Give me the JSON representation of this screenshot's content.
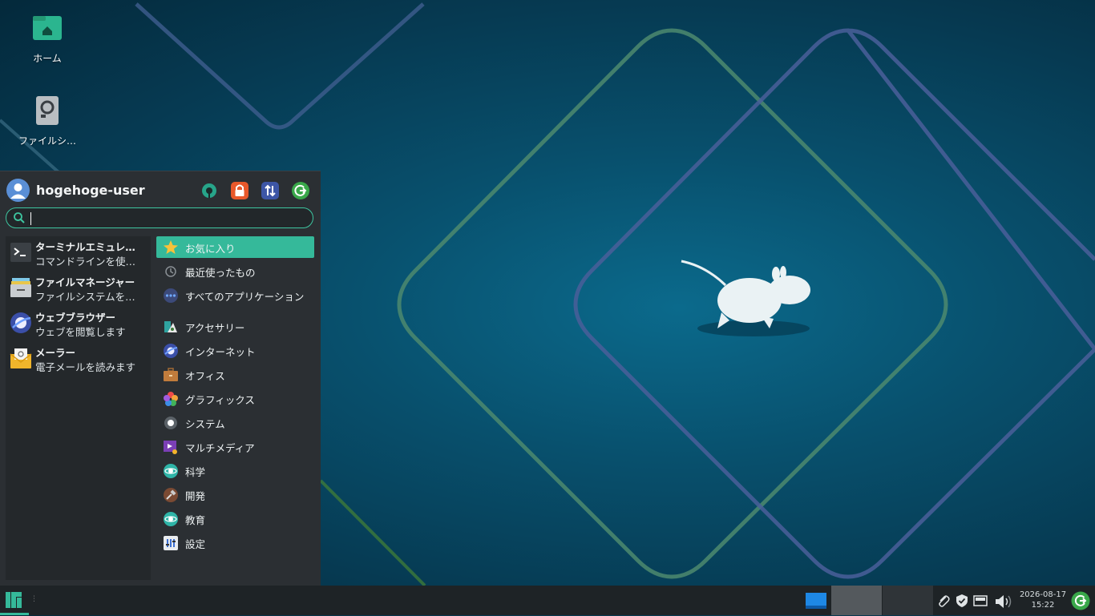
{
  "desktop": {
    "icons": [
      {
        "label": "ホーム",
        "icon": "home-folder-icon"
      },
      {
        "label": "ファイルシ…",
        "icon": "filesystem-drive-icon"
      }
    ]
  },
  "menu": {
    "username": "hogehoge-user",
    "header_buttons": [
      "settings-icon",
      "lock-icon",
      "switch-user-icon",
      "logout-icon"
    ],
    "search": {
      "value": "",
      "placeholder": ""
    },
    "favorites": [
      {
        "name": "ターミナルエミュレ…",
        "desc": "コマンドラインを使…",
        "icon": "terminal-icon"
      },
      {
        "name": "ファイルマネージャー",
        "desc": "ファイルシステムを…",
        "icon": "file-manager-icon"
      },
      {
        "name": "ウェブブラウザー",
        "desc": "ウェブを閲覧します",
        "icon": "web-browser-icon"
      },
      {
        "name": "メーラー",
        "desc": "電子メールを読みます",
        "icon": "mail-icon"
      }
    ],
    "categories": [
      {
        "label": "お気に入り",
        "icon": "star-icon",
        "selected": true
      },
      {
        "label": "最近使ったもの",
        "icon": "clock-icon"
      },
      {
        "label": "すべてのアプリケーション",
        "icon": "all-apps-icon"
      },
      {
        "label": "アクセサリー",
        "icon": "accessories-icon"
      },
      {
        "label": "インターネット",
        "icon": "internet-icon"
      },
      {
        "label": "オフィス",
        "icon": "office-icon"
      },
      {
        "label": "グラフィックス",
        "icon": "graphics-icon"
      },
      {
        "label": "システム",
        "icon": "system-icon"
      },
      {
        "label": "マルチメディア",
        "icon": "multimedia-icon"
      },
      {
        "label": "科学",
        "icon": "science-icon"
      },
      {
        "label": "開発",
        "icon": "development-icon"
      },
      {
        "label": "教育",
        "icon": "education-icon"
      },
      {
        "label": "設定",
        "icon": "settings-category-icon"
      }
    ]
  },
  "taskbar": {
    "clock_date": "2026-08-17",
    "clock_time": "15:22",
    "tray_icons": [
      "paperclip-icon",
      "shield-icon",
      "network-icon",
      "volume-icon"
    ]
  },
  "colors": {
    "accent": "#35b99a",
    "menu_bg": "#2b2f33",
    "taskbar_bg": "#1e2326"
  }
}
